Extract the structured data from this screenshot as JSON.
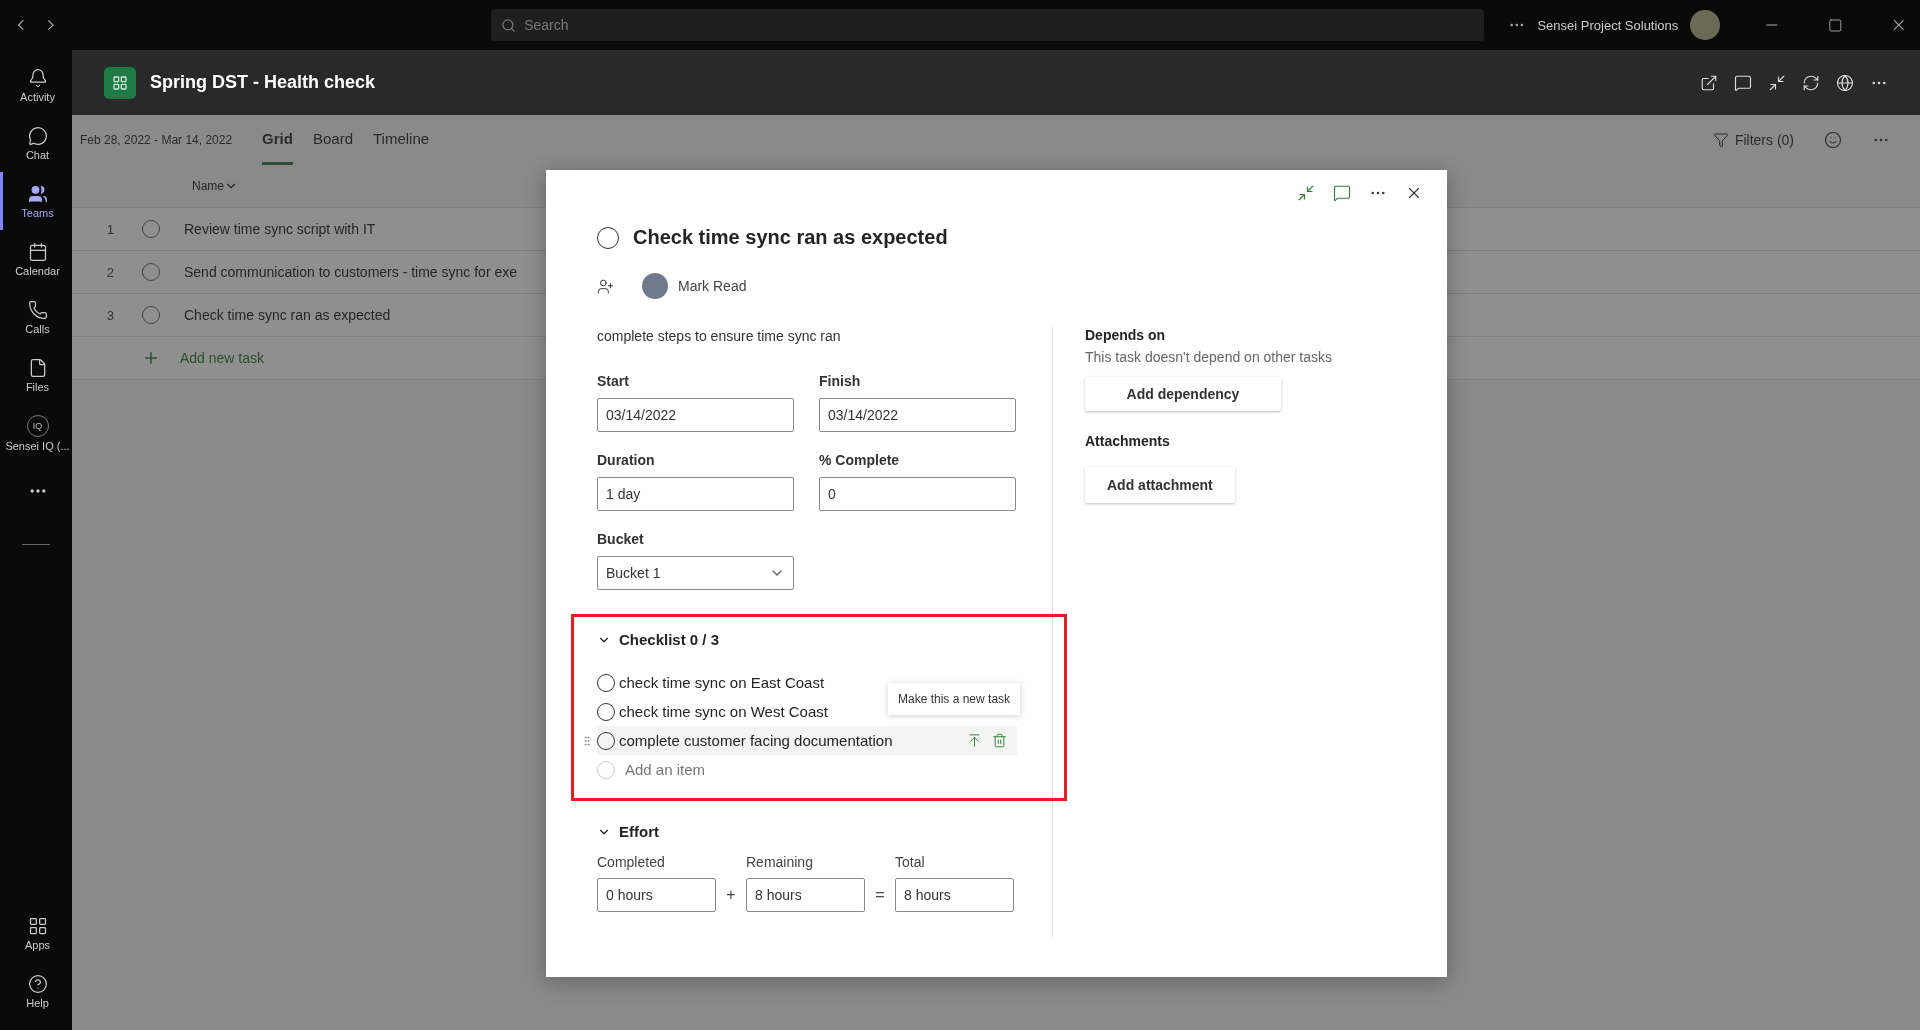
{
  "title_bar": {
    "search_placeholder": "Search",
    "org": "Sensei Project Solutions"
  },
  "rail": [
    {
      "kind": "bell",
      "label": "Activity",
      "selected": false
    },
    {
      "kind": "chat",
      "label": "Chat",
      "selected": false
    },
    {
      "kind": "teams",
      "label": "Teams",
      "selected": true
    },
    {
      "kind": "calendar",
      "label": "Calendar",
      "selected": false
    },
    {
      "kind": "calls",
      "label": "Calls",
      "selected": false
    },
    {
      "kind": "file",
      "label": "Files",
      "selected": false
    },
    {
      "kind": "iq",
      "label": "Sensei IQ (...",
      "badge": "IQ",
      "selected": false
    }
  ],
  "rail_bottom": [
    {
      "kind": "apps",
      "label": "Apps"
    },
    {
      "kind": "help",
      "label": "Help"
    }
  ],
  "header": {
    "title": "Spring DST - Health check"
  },
  "subbar": {
    "date_range": "Feb 28, 2022 - Mar 14, 2022",
    "tabs": [
      {
        "label": "Grid",
        "selected": true
      },
      {
        "label": "Board",
        "selected": false
      },
      {
        "label": "Timeline",
        "selected": false
      }
    ],
    "filters": "Filters (0)"
  },
  "grid": {
    "column": "Name",
    "rows": [
      {
        "number": "1",
        "name": "Review time sync script with IT"
      },
      {
        "number": "2",
        "name": "Send communication to customers - time sync for exe"
      },
      {
        "number": "3",
        "name": "Check time sync ran as expected"
      }
    ],
    "add_label": "Add new task"
  },
  "task": {
    "title": "Check time sync ran as expected",
    "completed": false,
    "assignee": "Mark Read",
    "notes": "complete steps to ensure time sync ran",
    "fields": [
      {
        "label": "Start",
        "value": "03/14/2022"
      },
      {
        "label": "Finish",
        "value": "03/14/2022"
      },
      {
        "label": "Duration",
        "value": "1 day"
      },
      {
        "label": "% Complete",
        "value": "0"
      }
    ],
    "bucket": {
      "label": "Bucket",
      "value": "Bucket 1"
    },
    "checklist": {
      "title": "Checklist 0 / 3",
      "expanded": true,
      "highlighted": true,
      "tooltip": "Make this a new task",
      "add_placeholder": "Add an item",
      "items": [
        {
          "text": "check time sync on East Coast",
          "checked": false,
          "hovered": false
        },
        {
          "text": "check time sync on West Coast",
          "checked": false,
          "hovered": false
        },
        {
          "text": "complete customer facing documentation",
          "checked": false,
          "hovered": true
        }
      ]
    },
    "effort": {
      "title": "Effort",
      "expanded": true,
      "completed": {
        "label": "Completed",
        "value": "0 hours"
      },
      "remaining": {
        "label": "Remaining",
        "value": "8 hours"
      },
      "total": {
        "label": "Total",
        "value": "8 hours"
      },
      "plus": "+",
      "equals": "="
    },
    "depends": {
      "title": "Depends on",
      "text": "This task doesn't depend on other tasks",
      "button": "Add dependency"
    },
    "attachments": {
      "title": "Attachments",
      "button": "Add attachment"
    }
  }
}
